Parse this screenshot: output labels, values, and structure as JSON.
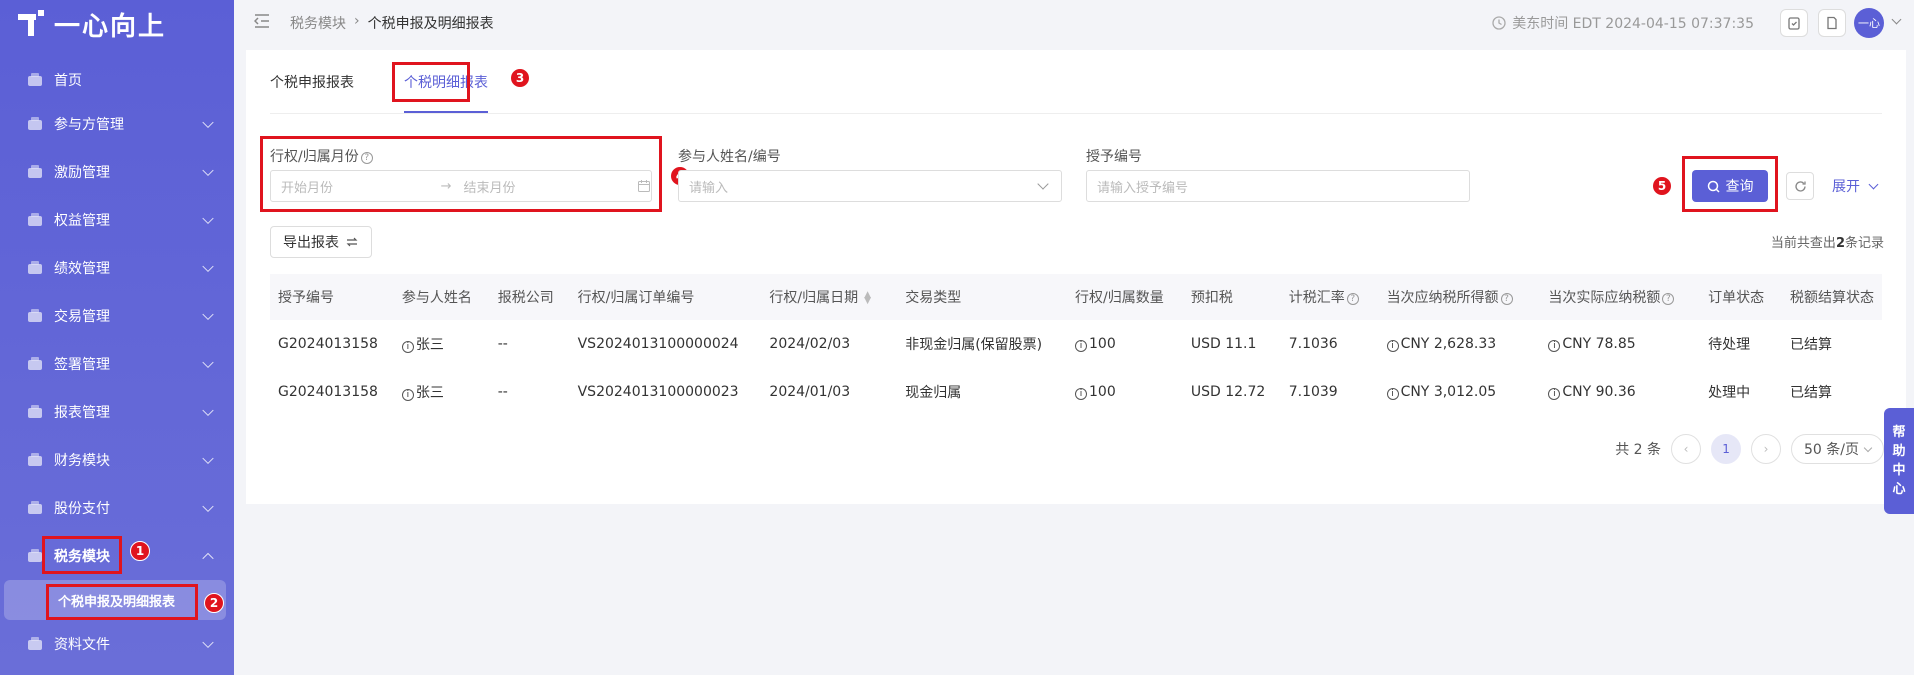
{
  "app": {
    "logo_text": "一心向上"
  },
  "sidebar": {
    "items": [
      {
        "label": "首页",
        "icon": "home-icon",
        "has_chevron": false
      },
      {
        "label": "参与方管理",
        "icon": "participants-icon",
        "has_chevron": true
      },
      {
        "label": "激励管理",
        "icon": "incentive-icon",
        "has_chevron": true
      },
      {
        "label": "权益管理",
        "icon": "equity-icon",
        "has_chevron": true
      },
      {
        "label": "绩效管理",
        "icon": "performance-icon",
        "has_chevron": true
      },
      {
        "label": "交易管理",
        "icon": "trade-icon",
        "has_chevron": true
      },
      {
        "label": "签署管理",
        "icon": "sign-icon",
        "has_chevron": true
      },
      {
        "label": "报表管理",
        "icon": "report-icon",
        "has_chevron": true
      },
      {
        "label": "财务模块",
        "icon": "finance-icon",
        "has_chevron": true
      },
      {
        "label": "股份支付",
        "icon": "share-payment-icon",
        "has_chevron": true
      },
      {
        "label": "税务模块",
        "icon": "tax-icon",
        "has_chevron": true,
        "expanded": true
      },
      {
        "label": "资料文件",
        "icon": "files-icon",
        "has_chevron": true
      }
    ],
    "sub_item": "个税申报及明细报表"
  },
  "header": {
    "breadcrumb": [
      "税务模块",
      "个税申报及明细报表"
    ],
    "time": "美东时间 EDT 2024-04-15 07:37:35",
    "avatar": "一心"
  },
  "tabs": [
    {
      "label": "个税申报报表",
      "active": false
    },
    {
      "label": "个税明细报表",
      "active": true
    }
  ],
  "filters": {
    "period_label": "行权/归属月份",
    "start_placeholder": "开始月份",
    "end_placeholder": "结束月份",
    "participant_label": "参与人姓名/编号",
    "participant_placeholder": "请输入",
    "grant_label": "授予编号",
    "grant_placeholder": "请输入授予编号",
    "search_label": "查询",
    "expand_label": "展开"
  },
  "export_label": "导出报表",
  "total": {
    "prefix": "当前共查出",
    "count": "2",
    "suffix": "条记录"
  },
  "table": {
    "columns": [
      "授予编号",
      "参与人姓名",
      "报税公司",
      "行权/归属订单编号",
      "行权/归属日期",
      "交易类型",
      "行权/归属数量",
      "预扣税",
      "计税汇率",
      "当次应纳税所得额",
      "当次实际应纳税额",
      "订单状态",
      "税额结算状态"
    ],
    "rows": [
      [
        "G2024013158",
        "张三",
        "--",
        "VS2024013100000024",
        "2024/02/03",
        "非现金归属(保留股票)",
        "100",
        "USD 11.1",
        "7.1036",
        "CNY 2,628.33",
        "CNY 78.85",
        "待处理",
        "已结算"
      ],
      [
        "G2024013158",
        "张三",
        "--",
        "VS2024013100000023",
        "2024/01/03",
        "现金归属",
        "100",
        "USD 12.72",
        "7.1039",
        "CNY 3,012.05",
        "CNY 90.36",
        "处理中",
        "已结算"
      ]
    ]
  },
  "pagination": {
    "total_text": "共 2 条",
    "current_page": "1",
    "page_size": "50 条/页"
  },
  "help_center": [
    "帮",
    "助",
    "中",
    "心"
  ],
  "annotations": [
    "1",
    "2",
    "3",
    "4",
    "5"
  ],
  "colors": {
    "primary": "#5b5fd6",
    "annotation_red": "#e0141e"
  }
}
